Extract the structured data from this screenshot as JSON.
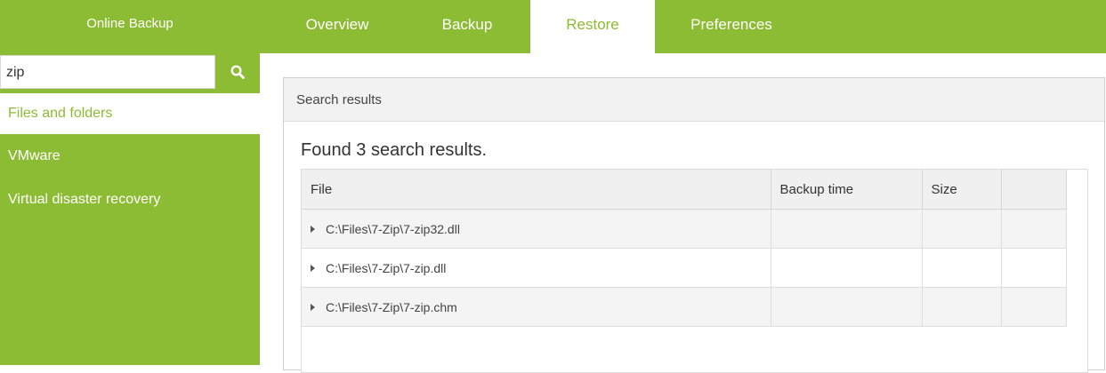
{
  "header": {
    "brand": "Online Backup",
    "tabs": [
      "Overview",
      "Backup",
      "Restore",
      "Preferences"
    ],
    "active_tab": "Restore"
  },
  "colors": {
    "accent": "#8cbc33",
    "panel_header_bg": "#f2f2f2"
  },
  "sidebar": {
    "search": {
      "value": "zip",
      "icon": "search-icon"
    },
    "items": [
      {
        "label": "Files and folders",
        "active": true
      },
      {
        "label": "VMware",
        "active": false
      },
      {
        "label": "Virtual disaster recovery",
        "active": false
      }
    ]
  },
  "panel": {
    "title": "Search results",
    "summary": "Found 3 search results.",
    "columns": [
      "File",
      "Backup time",
      "Size",
      ""
    ],
    "rows": [
      {
        "file": "C:\\Files\\7-Zip\\7-zip32.dll",
        "backup_time": "",
        "size": ""
      },
      {
        "file": "C:\\Files\\7-Zip\\7-zip.dll",
        "backup_time": "",
        "size": ""
      },
      {
        "file": "C:\\Files\\7-Zip\\7-zip.chm",
        "backup_time": "",
        "size": ""
      }
    ]
  }
}
